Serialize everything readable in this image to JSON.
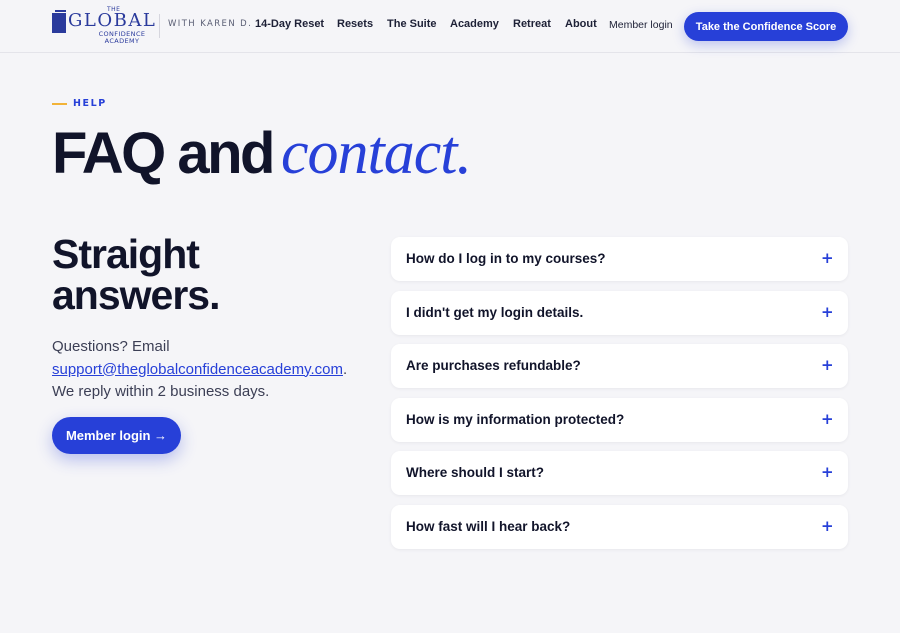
{
  "header": {
    "logo": {
      "the": "THE",
      "global": "GLOBAL",
      "confidence": "CONFIDENCE",
      "academy": "ACADEMY"
    },
    "with_label": "WITH KAREN D.",
    "nav": [
      {
        "label": "14-Day Reset"
      },
      {
        "label": "Resets"
      },
      {
        "label": "The Suite"
      },
      {
        "label": "Academy"
      },
      {
        "label": "Retreat"
      },
      {
        "label": "About"
      }
    ],
    "member_login": "Member login",
    "cta": "Take the Confidence Score"
  },
  "hero": {
    "eyebrow": "HELP",
    "title_bold": "FAQ and",
    "title_italic": "contact."
  },
  "left": {
    "heading": "Straight answers.",
    "question_prefix": "Questions? Email",
    "email": "support@theglobalconfidenceacademy.com",
    "question_suffix": ".",
    "reply_text": "We reply within 2 business days.",
    "button": "Member login →"
  },
  "faq": [
    {
      "question": "How do I log in to my courses?"
    },
    {
      "question": "I didn't get my login details."
    },
    {
      "question": "Are purchases refundable?"
    },
    {
      "question": "How is my information protected?"
    },
    {
      "question": "Where should I start?"
    },
    {
      "question": "How fast will I hear back?"
    }
  ],
  "icons": {
    "expand": "plus-icon",
    "logo": "book-icon"
  },
  "colors": {
    "accent": "#2740d8",
    "eyebrow_line": "#f2b338",
    "background": "#f5f5f8"
  }
}
